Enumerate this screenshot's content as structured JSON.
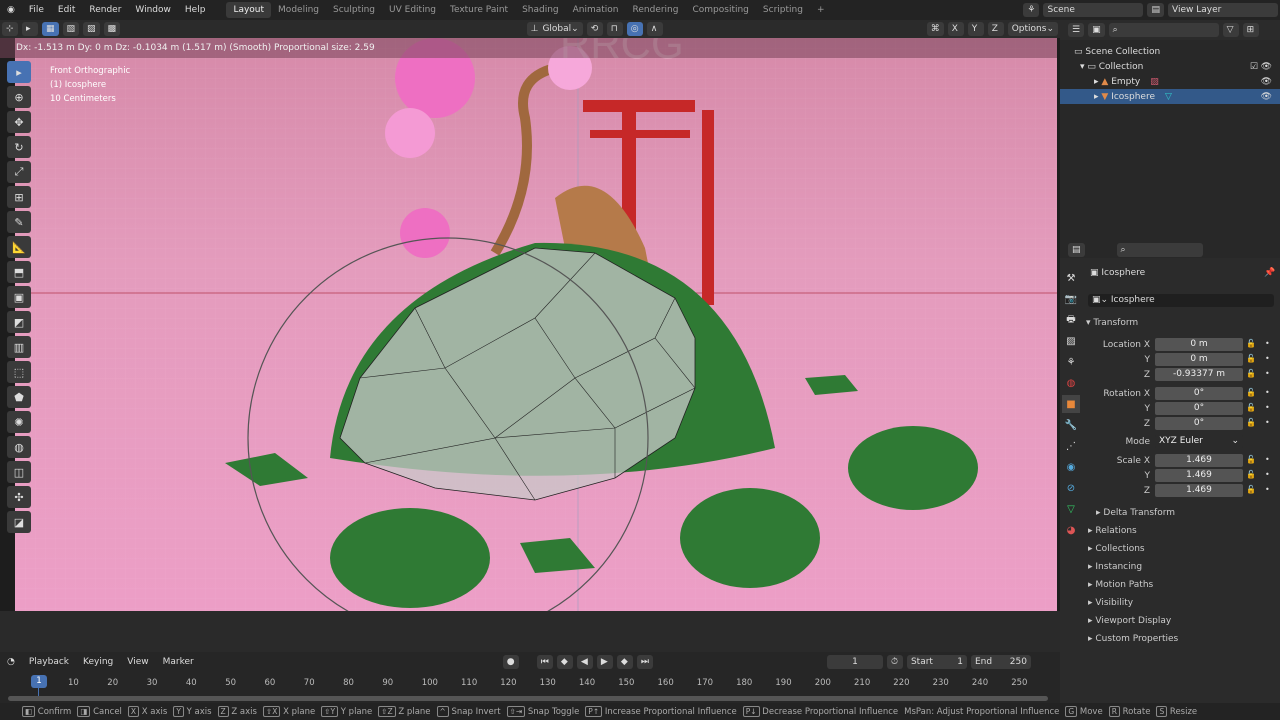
{
  "menu": [
    "File",
    "Edit",
    "Render",
    "Window",
    "Help"
  ],
  "workspaces": [
    "Layout",
    "Modeling",
    "Sculpting",
    "UV Editing",
    "Texture Paint",
    "Shading",
    "Animation",
    "Rendering",
    "Compositing",
    "Scripting",
    "+"
  ],
  "scene": "Scene",
  "view_layer": "View Layer",
  "header": {
    "orientation": "Global",
    "axes": [
      "X",
      "Y",
      "Z"
    ],
    "options": "Options"
  },
  "transform_info": "Dx: -1.513 m  Dy: 0 m  Dz: -0.1034 m (1.517 m) (Smooth)  Proportional size: 2.59",
  "overlay": {
    "view": "Front Orthographic",
    "object": "(1) Icosphere",
    "scale": "10 Centimeters"
  },
  "tools": [
    "select-box",
    "cursor",
    "move",
    "rotate",
    "scale",
    "transform",
    "annotate",
    "measure",
    "extrude",
    "inset",
    "bevel",
    "loop-cut",
    "knife",
    "poly-build",
    "spin",
    "smooth",
    "shrink",
    "shear",
    "rip"
  ],
  "outliner": {
    "scene_collection": "Scene Collection",
    "collection": "Collection",
    "items": [
      "Empty",
      "Icosphere"
    ]
  },
  "properties": {
    "object_name": "Icosphere",
    "data_name": "Icosphere",
    "transform": "Transform",
    "location_label": "Location X",
    "rotation_label": "Rotation X",
    "scale_label": "Scale X",
    "mode_label": "Mode",
    "location": [
      "0 m",
      "0 m",
      "-0.93377 m"
    ],
    "rotation": [
      "0°",
      "0°",
      "0°"
    ],
    "mode": "XYZ Euler",
    "scale": [
      "1.469",
      "1.469",
      "1.469"
    ],
    "axis_y": "Y",
    "axis_z": "Z",
    "sections": [
      "Delta Transform",
      "Relations",
      "Collections",
      "Instancing",
      "Motion Paths",
      "Visibility",
      "Viewport Display",
      "Custom Properties"
    ]
  },
  "timeline": {
    "menus": [
      "Playback",
      "Keying",
      "View",
      "Marker"
    ],
    "current_frame": "1",
    "start_label": "Start",
    "start": "1",
    "end_label": "End",
    "end": "250",
    "ticks": [
      "10",
      "20",
      "30",
      "40",
      "50",
      "60",
      "70",
      "80",
      "90",
      "100",
      "110",
      "120",
      "130",
      "140",
      "150",
      "160",
      "170",
      "180",
      "190",
      "200",
      "210",
      "220",
      "230",
      "240",
      "250"
    ]
  },
  "status": [
    {
      "k": "◧",
      "t": "Confirm"
    },
    {
      "k": "◨",
      "t": "Cancel"
    },
    {
      "k": "X",
      "t": "X axis"
    },
    {
      "k": "Y",
      "t": "Y axis"
    },
    {
      "k": "Z",
      "t": "Z axis"
    },
    {
      "k": "⇧X",
      "t": "X plane"
    },
    {
      "k": "⇧Y",
      "t": "Y plane"
    },
    {
      "k": "⇧Z",
      "t": "Z plane"
    },
    {
      "k": "^",
      "t": "Snap Invert"
    },
    {
      "k": "⇧⇥",
      "t": "Snap Toggle"
    },
    {
      "k": "P↑",
      "t": "Increase Proportional Influence"
    },
    {
      "k": "P↓",
      "t": "Decrease Proportional Influence"
    },
    {
      "k": "",
      "t": "MsPan: Adjust Proportional Influence"
    },
    {
      "k": "G",
      "t": "Move"
    },
    {
      "k": "R",
      "t": "Rotate"
    },
    {
      "k": "S",
      "t": "Resize"
    }
  ],
  "watermark": "RRCG 人人素材",
  "colors": {
    "selection": "#4772b3",
    "viewport_bg": "#e49cbd",
    "mesh_green": "#2e7d32",
    "torii_red": "#c62828"
  }
}
